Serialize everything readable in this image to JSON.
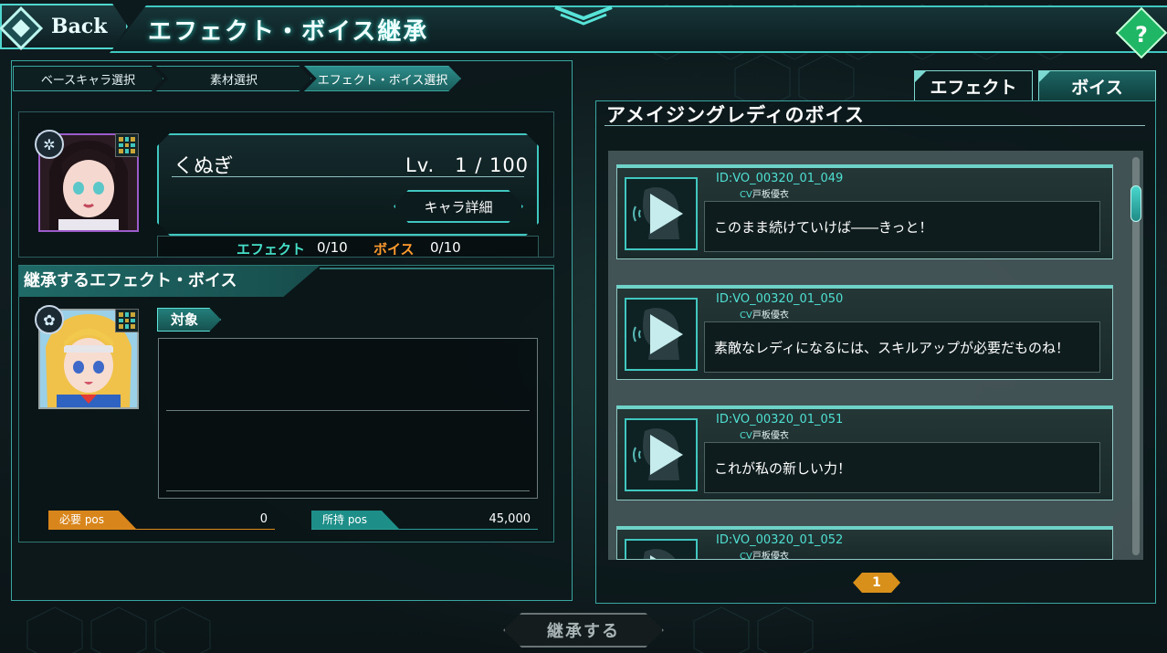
{
  "header": {
    "back_label": "Back",
    "title": "エフェクト・ボイス継承",
    "help_label": "?"
  },
  "steps": [
    {
      "label": "ベースキャラ選択"
    },
    {
      "label": "素材選択"
    },
    {
      "label": "エフェクト・ボイス選択"
    }
  ],
  "base_character": {
    "name": "くぬぎ",
    "level": "Lv.　1 / 100",
    "detail_label": "キャラ詳細",
    "effect_label": "エフェクト",
    "effect_count": "0/10",
    "voice_label": "ボイス",
    "voice_count": "0/10"
  },
  "inherit_section": {
    "heading": "継承するエフェクト・ボイス",
    "target_label": "対象",
    "required_pos_label": "必要 pos",
    "required_pos_value": "0",
    "owned_pos_label": "所持 pos",
    "owned_pos_value": "45,000"
  },
  "tabs": [
    {
      "label": "エフェクト",
      "active": false
    },
    {
      "label": "ボイス",
      "active": true
    }
  ],
  "voice_panel": {
    "title": "アメイジングレディのボイス",
    "items": [
      {
        "id": "ID:VO_00320_01_049",
        "cv_prefix": "CV",
        "cv_name": "戸板優衣",
        "line": "このまま続けていけば――きっと！"
      },
      {
        "id": "ID:VO_00320_01_050",
        "cv_prefix": "CV",
        "cv_name": "戸板優衣",
        "line": "素敵なレディになるには、スキルアップが必要だものね！"
      },
      {
        "id": "ID:VO_00320_01_051",
        "cv_prefix": "CV",
        "cv_name": "戸板優衣",
        "line": "これが私の新しい力！"
      },
      {
        "id": "ID:VO_00320_01_052",
        "cv_prefix": "CV",
        "cv_name": "戸板優衣",
        "line": ""
      }
    ],
    "page": "1"
  },
  "footer": {
    "inherit_button_label": "継承する"
  },
  "colors": {
    "accent": "#3fc7c0",
    "effect": "#46e0c9",
    "voice": "#ff9a2e",
    "required_pos": "#d8851b",
    "owned_pos": "#1d8f88"
  }
}
